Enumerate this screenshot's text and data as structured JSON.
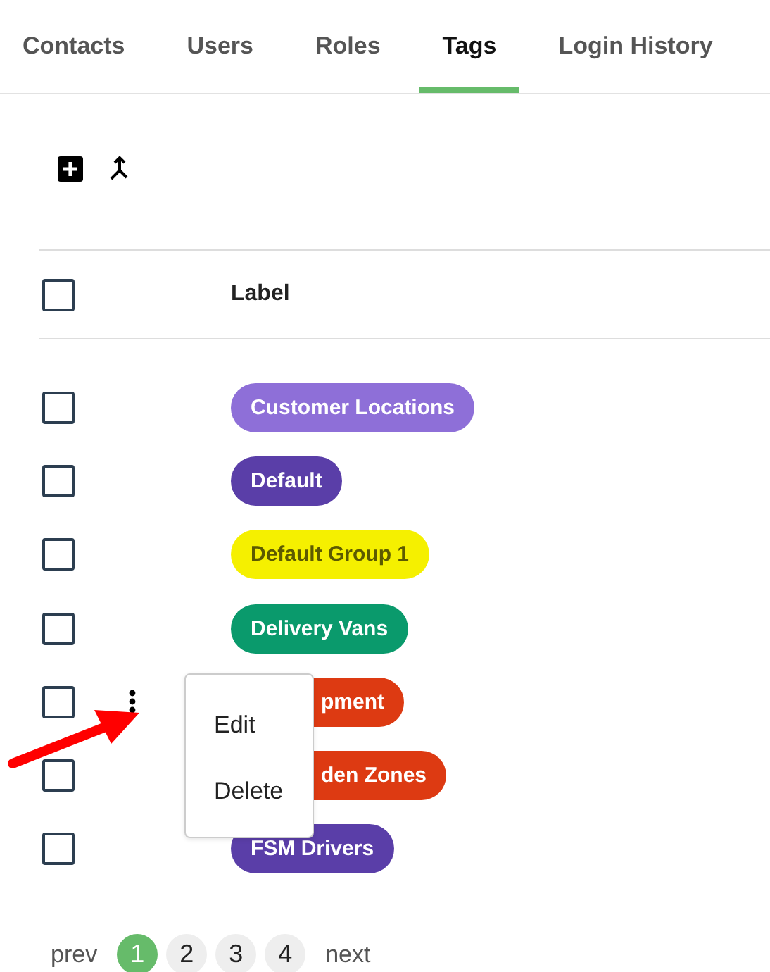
{
  "tabs": [
    {
      "label": "Contacts",
      "selected": false
    },
    {
      "label": "Users",
      "selected": false
    },
    {
      "label": "Roles",
      "selected": false
    },
    {
      "label": "Tags",
      "selected": true
    },
    {
      "label": "Login History",
      "selected": false
    }
  ],
  "table": {
    "header": {
      "checked": false,
      "label": "Label"
    },
    "rows": [
      {
        "checked": false,
        "tag": "Customer Locations",
        "color": "#8e6fd8",
        "actions_visible": false,
        "tag_hidden_under_menu": false
      },
      {
        "checked": false,
        "tag": "Default",
        "color": "#5a3ea8",
        "actions_visible": false,
        "tag_hidden_under_menu": false
      },
      {
        "checked": false,
        "tag": "Default Group 1",
        "color": "#f5f000",
        "actions_visible": false,
        "tag_hidden_under_menu": false
      },
      {
        "checked": false,
        "tag": "Delivery Vans",
        "color": "#0a9a6c",
        "actions_visible": false,
        "tag_hidden_under_menu": false
      },
      {
        "checked": false,
        "tag": "pment",
        "color": "#dd3a12",
        "actions_visible": true,
        "tag_hidden_under_menu": true
      },
      {
        "checked": false,
        "tag": "den Zones",
        "color": "#dd3a12",
        "actions_visible": false,
        "tag_hidden_under_menu": true
      },
      {
        "checked": false,
        "tag": "FSM Drivers",
        "color": "#5a3ea8",
        "actions_visible": false,
        "tag_hidden_under_menu": false
      }
    ]
  },
  "context_menu": {
    "items": [
      "Edit",
      "Delete"
    ]
  },
  "pagination": {
    "prev": "prev",
    "next": "next",
    "pages": [
      {
        "label": "1",
        "selected": true
      },
      {
        "label": "2",
        "selected": false
      },
      {
        "label": "3",
        "selected": false
      },
      {
        "label": "4",
        "selected": false
      }
    ]
  }
}
